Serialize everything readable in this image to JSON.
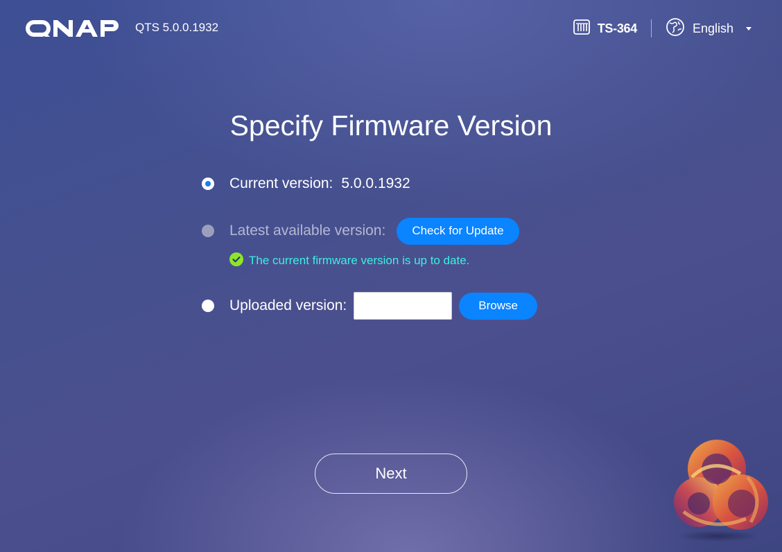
{
  "header": {
    "brand": "QNAP",
    "product_version": "QTS 5.0.0.1932",
    "model": "TS-364",
    "language": "English",
    "icons": {
      "model": "nas-device-icon",
      "language": "globe-icon",
      "language_dropdown": "caret-down-icon"
    }
  },
  "title": "Specify Firmware Version",
  "options": {
    "current": {
      "label": "Current version:",
      "value": "5.0.0.1932",
      "selected": true
    },
    "latest": {
      "label": "Latest available version:",
      "button_label": "Check for Update",
      "disabled": true
    },
    "status": {
      "text": "The current firmware version is up to date.",
      "icon": "check-circle-icon"
    },
    "uploaded": {
      "label": "Uploaded version:",
      "input_value": "",
      "button_label": "Browse"
    }
  },
  "footer": {
    "next_label": "Next"
  },
  "colors": {
    "accent": "#0a84ff",
    "status_text": "#3df0e0",
    "status_icon": "#8ee62b",
    "radio_selected": "#1a7fe8"
  }
}
